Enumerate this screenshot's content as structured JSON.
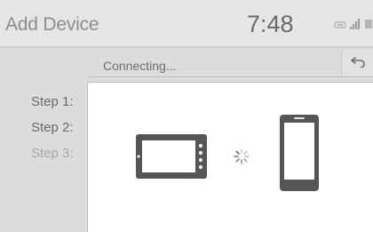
{
  "header": {
    "title": "Add Device",
    "clock": "7:48"
  },
  "dialog": {
    "status": "Connecting..."
  },
  "steps": [
    {
      "label": "Step 1:",
      "state": "done"
    },
    {
      "label": "Step 2:",
      "state": "done"
    },
    {
      "label": "Step 3:",
      "state": "pending"
    }
  ],
  "icons": {
    "back": "back-arrow-icon",
    "car_unit": "head-unit-display-icon",
    "phone": "smartphone-icon",
    "loading": "loading-spinner-icon",
    "signal": "signal-strength-icon",
    "battery": "battery-icon",
    "bluetooth": "bluetooth-icon"
  },
  "colors": {
    "background": "#dcdcdc",
    "panel": "#ffffff",
    "text": "#6a6a6a",
    "text_muted": "#a8a8a8",
    "icon": "#555555"
  }
}
